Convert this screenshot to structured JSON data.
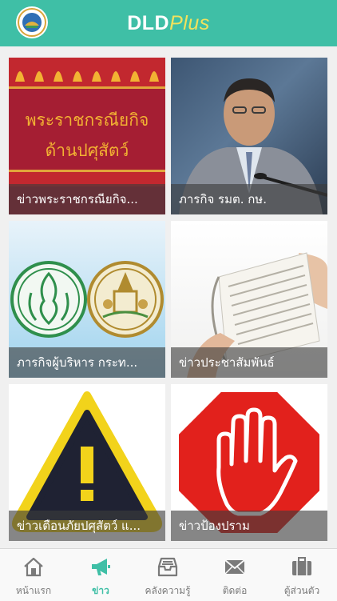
{
  "header": {
    "title_main": "DLD",
    "title_accent": "Plus"
  },
  "cards": [
    {
      "caption": "ข่าวพระราชกรณียกิจ...",
      "image_text_1": "พระราชกรณียกิจ",
      "image_text_2": "ด้านปศุสัตว์"
    },
    {
      "caption": "ภารกิจ รมต. กษ."
    },
    {
      "caption": "ภารกิจผู้บริหาร กระท..."
    },
    {
      "caption": "ข่าวประชาสัมพันธ์"
    },
    {
      "caption": "ข่าวเตือนภัยปศุสัตว์ แ..."
    },
    {
      "caption": "ข่าวป้องปราม"
    }
  ],
  "tabbar": {
    "items": [
      {
        "label": "หน้าแรก",
        "icon": "home-icon"
      },
      {
        "label": "ข่าว",
        "icon": "megaphone-icon",
        "active": true
      },
      {
        "label": "คลังความรู้",
        "icon": "inbox-icon"
      },
      {
        "label": "ติดต่อ",
        "icon": "envelope-icon"
      },
      {
        "label": "ตู้ส่วนตัว",
        "icon": "briefcase-icon"
      }
    ]
  },
  "colors": {
    "brand": "#3fbfa6",
    "accent": "#f2e25c"
  }
}
